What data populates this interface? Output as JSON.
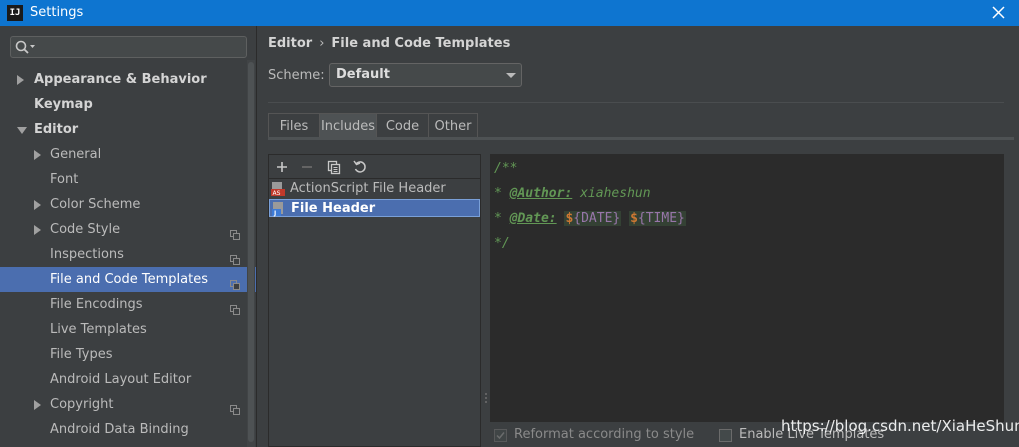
{
  "window": {
    "title": "Settings",
    "app_icon_text": "IJ"
  },
  "search": {
    "placeholder": ""
  },
  "tree": [
    {
      "label": "Appearance & Behavior",
      "bold": true,
      "arrow": "right",
      "indent": 0
    },
    {
      "label": "Keymap",
      "bold": true,
      "arrow": null,
      "indent": 0
    },
    {
      "label": "Editor",
      "bold": true,
      "arrow": "down",
      "indent": 0
    },
    {
      "label": "General",
      "bold": false,
      "arrow": "right",
      "indent": 1
    },
    {
      "label": "Font",
      "bold": false,
      "arrow": null,
      "indent": 1
    },
    {
      "label": "Color Scheme",
      "bold": false,
      "arrow": "right",
      "indent": 1
    },
    {
      "label": "Code Style",
      "bold": false,
      "arrow": "right",
      "indent": 1,
      "copy": true
    },
    {
      "label": "Inspections",
      "bold": false,
      "arrow": null,
      "indent": 1,
      "copy": true
    },
    {
      "label": "File and Code Templates",
      "bold": false,
      "arrow": null,
      "indent": 1,
      "copy": true,
      "selected": true
    },
    {
      "label": "File Encodings",
      "bold": false,
      "arrow": null,
      "indent": 1,
      "copy": true
    },
    {
      "label": "Live Templates",
      "bold": false,
      "arrow": null,
      "indent": 1
    },
    {
      "label": "File Types",
      "bold": false,
      "arrow": null,
      "indent": 1
    },
    {
      "label": "Android Layout Editor",
      "bold": false,
      "arrow": null,
      "indent": 1
    },
    {
      "label": "Copyright",
      "bold": false,
      "arrow": "right",
      "indent": 1,
      "copy": true
    },
    {
      "label": "Android Data Binding",
      "bold": false,
      "arrow": null,
      "indent": 1
    }
  ],
  "breadcrumb": {
    "parent": "Editor",
    "separator": "›",
    "current": "File and Code Templates"
  },
  "scheme": {
    "label": "Scheme:",
    "value": "Default"
  },
  "tabs": [
    {
      "label": "Files",
      "selected": false
    },
    {
      "label": "Includes",
      "selected": true
    },
    {
      "label": "Code",
      "selected": false
    },
    {
      "label": "Other",
      "selected": false
    }
  ],
  "toolbar": {
    "add": "+",
    "remove": "−",
    "copy_icon": "copy-icon",
    "reset_icon": "reset-icon"
  },
  "templates": [
    {
      "label": "ActionScript File Header",
      "icon": "actionscript-file-icon",
      "selected": false
    },
    {
      "label": "File Header",
      "icon": "java-file-icon",
      "selected": true
    }
  ],
  "code": {
    "line1": "/**",
    "star": "* ",
    "author_tag": "@Author:",
    "author_value": " xiaheshun",
    "date_tag": "@Date:",
    "dollar1": "$",
    "brace_open": "{",
    "var1": "DATE",
    "brace_close": "}",
    "dollar2": "$",
    "var2": "TIME",
    "line4": "*/"
  },
  "options": {
    "reformat_label": "Reformat according to style",
    "reformat_checked": true,
    "live_templates_label": "Enable Live Templates",
    "live_templates_checked": false
  },
  "watermark": "https://blog.csdn.net/XiaHeShun",
  "colors": {
    "titlebar": "#0e75d0",
    "panel": "#3c3f41",
    "selection": "#4b6eaf",
    "editor_bg": "#2b2b2b",
    "comment": "#629755"
  }
}
